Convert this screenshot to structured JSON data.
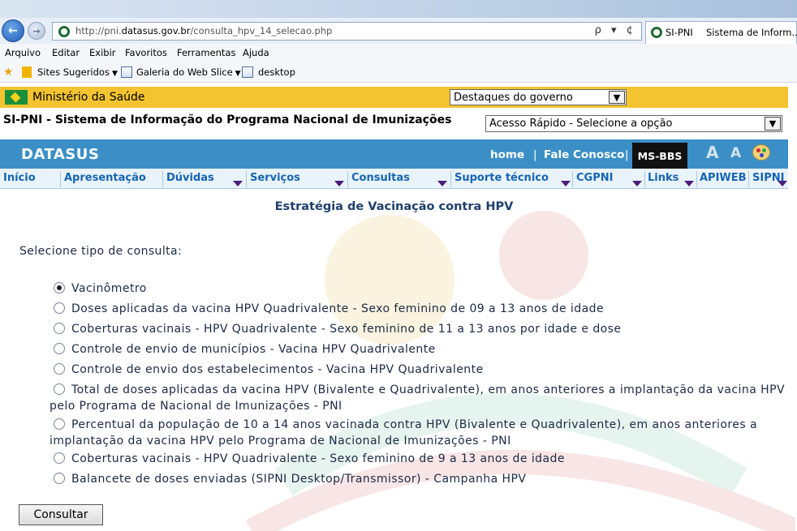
{
  "browser": {
    "url_prefix": "http://pni.",
    "url_domain": "datasus.gov.br",
    "url_path": "/consulta_hpv_14_selecao.php",
    "url_controls": "ρ ▾ ¢",
    "tab_label": "SI-PNI",
    "tab_title": "Sistema de Inform...",
    "menu": [
      "Arquivo",
      "Editar",
      "Exibir",
      "Favoritos",
      "Ferramentas",
      "Ajuda"
    ],
    "favorites": [
      "Sites Sugeridos",
      "Galeria do Web Slice",
      "desktop"
    ]
  },
  "site": {
    "ministry": "Ministério da Saúde",
    "gov_select": "Destaques do governo",
    "system_title": "SI-PNI - Sistema de Informação do Programa Nacional de Imunizações",
    "quick_access": "Acesso Rápido - Selecione a opção",
    "brand": "DATASUS",
    "links": [
      "home",
      "|",
      "Fale Conosco",
      "|"
    ],
    "ms_bbs": "MS-BBS",
    "font_large": "A",
    "font_small": "A",
    "nav": [
      "Início",
      "Apresentação",
      "Dúvidas",
      "Serviços",
      "Consultas",
      "Suporte técnico",
      "CGPNI",
      "Links",
      "APIWEB",
      "SIPNI"
    ]
  },
  "main": {
    "heading": "Estratégia de Vacinação contra HPV",
    "prompt": "Selecione tipo de consulta:",
    "options": [
      "Vacinômetro",
      "Doses aplicadas da vacina HPV Quadrivalente - Sexo feminino de 09 a 13 anos de idade",
      "Coberturas vacinais - HPV Quadrivalente - Sexo feminino de 11 a 13 anos por idade e dose",
      "Controle de envio de municípios - Vacina HPV Quadrivalente",
      "Controle de envio dos estabelecimentos - Vacina HPV Quadrivalente",
      "Total de doses aplicadas da vacina HPV (Bivalente e Quadrivalente), em anos anteriores a implantação da vacina HPV pelo Programa de Nacional de Imunizações - PNI",
      "Percentual da população de 10 a 14 anos vacinada contra HPV (Bivalente e Quadrivalente), em anos anteriores a implantação da vacina HPV pelo Programa de Nacional de Imunizações - PNI",
      "Coberturas vacinais - HPV Quadrivalente - Sexo feminino de 9 a 13 anos de idade",
      "Balancete de doses enviadas (SIPNI Desktop/Transmissor) - Campanha HPV"
    ],
    "selected_option": "Vacinômetro",
    "submit": "Consultar"
  }
}
